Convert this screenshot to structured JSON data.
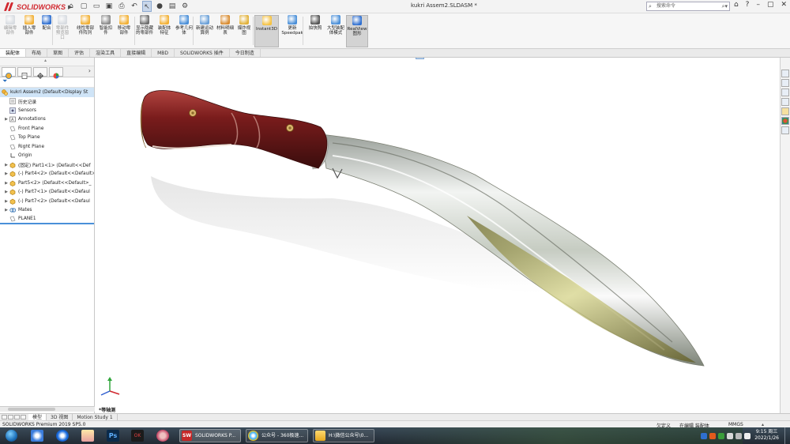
{
  "app": {
    "title": "kukri Assem2.SLDASM *",
    "logo_text": "SOLIDWORKS",
    "search_placeholder": "搜索命令"
  },
  "ribbon": {
    "buttons": [
      {
        "label": "编辑零部件",
        "state": "disabled"
      },
      {
        "label": "插入零部件",
        "state": "normal"
      },
      {
        "label": "配合",
        "state": "normal"
      },
      {
        "label": "零部件预览窗口",
        "state": "disabled"
      },
      {
        "label": "线性零部件阵列",
        "state": "normal"
      },
      {
        "label": "智能扣件",
        "state": "normal"
      },
      {
        "label": "移动零部件",
        "state": "normal"
      },
      {
        "label": "显示隐藏的零部件",
        "state": "normal"
      },
      {
        "label": "装配体特征",
        "state": "normal"
      },
      {
        "label": "参考几何体",
        "state": "normal"
      },
      {
        "label": "新建运动算例",
        "state": "normal"
      },
      {
        "label": "材料明细表",
        "state": "normal"
      },
      {
        "label": "爆炸视图",
        "state": "normal"
      },
      {
        "label": "Instant3D",
        "state": "active"
      },
      {
        "label": "更新Speedpak",
        "state": "normal"
      },
      {
        "label": "拍快照",
        "state": "normal"
      },
      {
        "label": "大型装配体模式",
        "state": "normal"
      },
      {
        "label": "RealView图形",
        "state": "active"
      }
    ]
  },
  "tabs": [
    "装配体",
    "布局",
    "草图",
    "评估",
    "渲染工具",
    "直接编辑",
    "MBD",
    "SOLIDWORKS 插件",
    "今日制造"
  ],
  "active_tab": 0,
  "tree": {
    "root": "kukri Assem2  (Default<Display St",
    "items": [
      {
        "label": "历史记录",
        "icon": "history-icon",
        "exp": ""
      },
      {
        "label": "Sensors",
        "icon": "sensor-icon",
        "exp": ""
      },
      {
        "label": "Annotations",
        "icon": "annotation-icon",
        "exp": "▶"
      },
      {
        "label": "Front Plane",
        "icon": "plane-icon",
        "exp": ""
      },
      {
        "label": "Top Plane",
        "icon": "plane-icon",
        "exp": ""
      },
      {
        "label": "Right Plane",
        "icon": "plane-icon",
        "exp": ""
      },
      {
        "label": "Origin",
        "icon": "origin-icon",
        "exp": ""
      },
      {
        "label": "(固定) Part1<1> (Default<<Def",
        "icon": "part-icon",
        "exp": "▶"
      },
      {
        "label": "(-) Part4<2> (Default<<Default>",
        "icon": "part-icon",
        "exp": "▶"
      },
      {
        "label": "Part5<2> (Default<<Default>_",
        "icon": "part-icon",
        "exp": "▶"
      },
      {
        "label": "(-) Part7<1> (Default<<Defaul",
        "icon": "part-icon",
        "exp": "▶"
      },
      {
        "label": "(-) Part7<2> (Default<<Defaul",
        "icon": "part-icon",
        "exp": "▶"
      },
      {
        "label": "Mates",
        "icon": "mates-icon",
        "exp": "▶"
      },
      {
        "label": "PLANE1",
        "icon": "plane-icon",
        "exp": ""
      }
    ]
  },
  "viewport": {
    "view_label": "*等轴测"
  },
  "bottom_tabs": [
    "模型",
    "3D 视图",
    "Motion Study 1"
  ],
  "status": {
    "version": "SOLIDWORKS Premium 2019 SP5.0",
    "state1": "欠定义",
    "state2": "在编辑 装配体",
    "units": "MMGS"
  },
  "taskbar": {
    "tasks": [
      "SOLIDWORKS P...",
      "公众号 - 360极速...",
      "H:\\微信公众号\\0..."
    ],
    "clock_time": "9:15 周三",
    "clock_date": "2022/1/26"
  },
  "colors": {
    "brand": "#d1282f",
    "handle": "#7a1c1c",
    "selection": "#cfe4f7"
  }
}
